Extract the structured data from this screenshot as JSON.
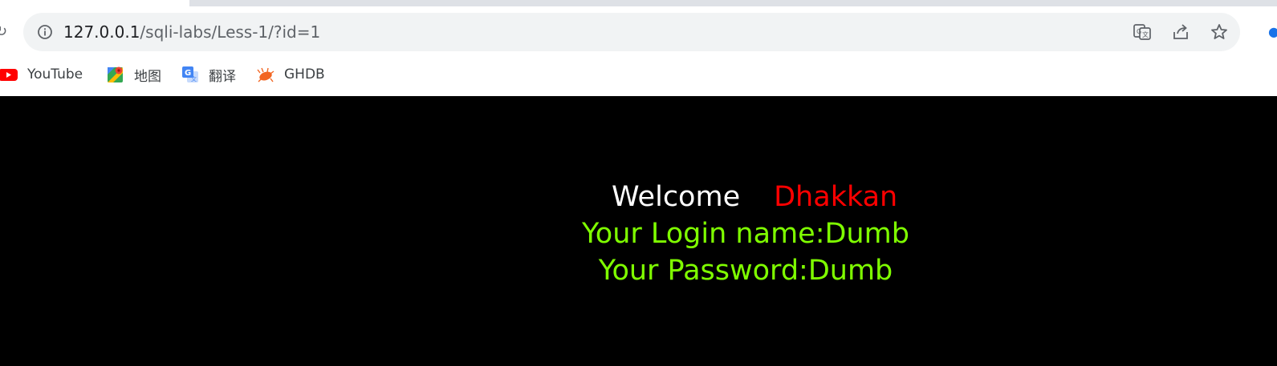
{
  "browser": {
    "url_host": "127.0.0.1",
    "url_path": "/sqli-labs/Less-1/?id=1",
    "bookmarks": [
      {
        "label": "YouTube",
        "icon": "youtube-icon"
      },
      {
        "label": "地图",
        "icon": "maps-icon"
      },
      {
        "label": "翻译",
        "icon": "translate-icon"
      },
      {
        "label": "GHDB",
        "icon": "ghdb-icon"
      }
    ]
  },
  "page": {
    "welcome": "Welcome",
    "username": "Dhakkan",
    "login_line": "Your Login name:Dumb",
    "password_line": "Your Password:Dumb",
    "colors": {
      "background": "#000000",
      "welcome": "#ffffff",
      "username": "#ff0000",
      "info": "#7fff00"
    }
  }
}
